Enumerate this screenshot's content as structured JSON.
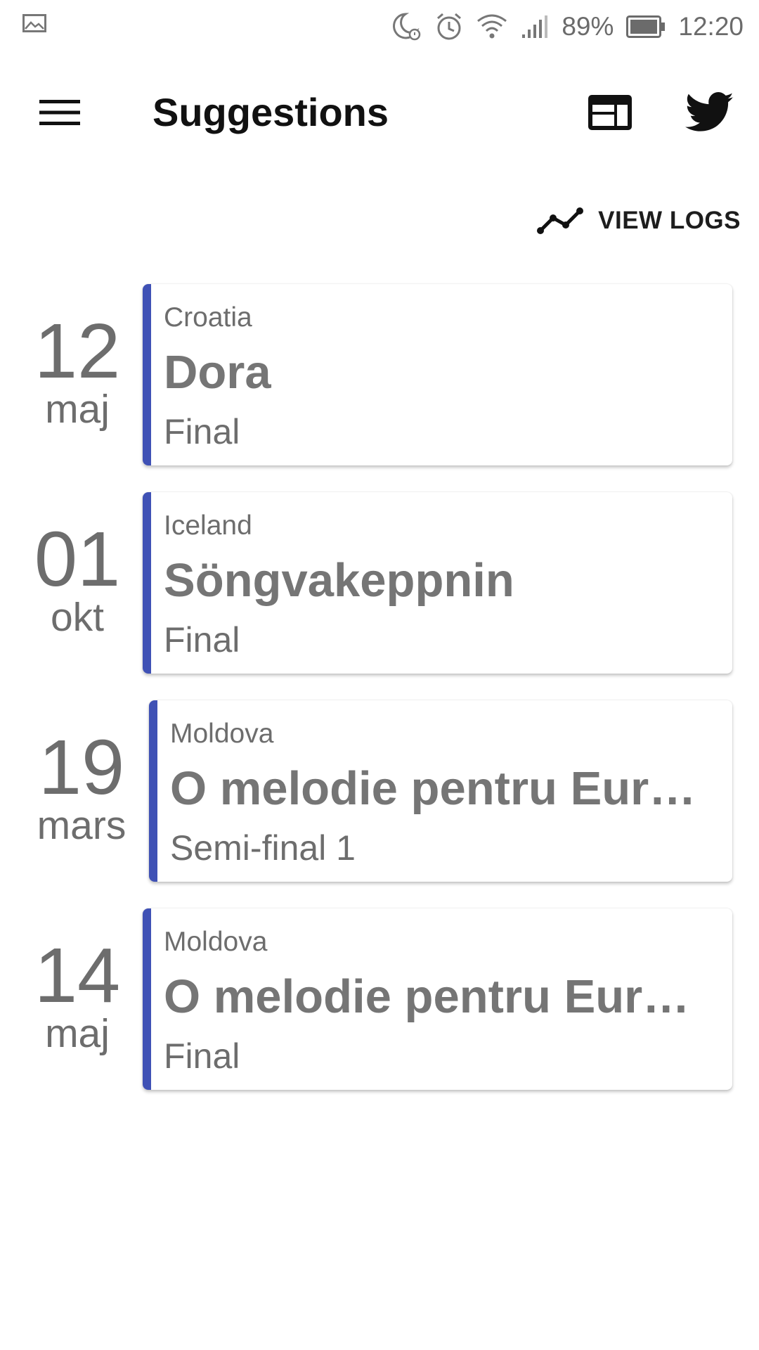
{
  "status_bar": {
    "battery": "89%",
    "time": "12:20",
    "icons": [
      "image-icon",
      "do-not-disturb-alarm-icon",
      "alarm-icon",
      "wifi-icon",
      "signal-icon",
      "battery-icon"
    ]
  },
  "app_bar": {
    "title": "Suggestions",
    "icons": [
      "menu-icon",
      "web-icon",
      "twitter-icon"
    ]
  },
  "view_logs": {
    "label": "VIEW LOGS",
    "icon": "timeline-icon"
  },
  "events": [
    {
      "day": "12",
      "month": "maj",
      "country": "Croatia",
      "name": "Dora",
      "stage": "Final"
    },
    {
      "day": "01",
      "month": "okt",
      "country": "Iceland",
      "name": "Söngvakeppnin",
      "stage": "Final"
    },
    {
      "day": "19",
      "month": "mars",
      "country": "Moldova",
      "name": "O melodie pentru Eur…",
      "stage": "Semi-final 1"
    },
    {
      "day": "14",
      "month": "maj",
      "country": "Moldova",
      "name": "O melodie pentru Euro…",
      "stage": "Final"
    }
  ],
  "colors": {
    "accent": "#3f51b5",
    "text_muted": "#6d6d6d",
    "title": "#111111"
  }
}
